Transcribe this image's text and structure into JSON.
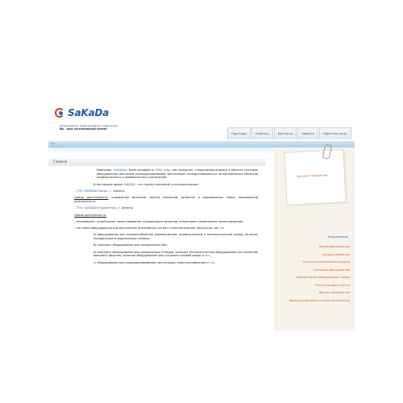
{
  "brand": {
    "logo_text": "SaKaDa",
    "tagline_line1": "Оборудование, проектирование, инвестиции",
    "tagline_line2": "Вы – ваш эксклюзивный клиент"
  },
  "nav": [
    {
      "label": "Партнеры"
    },
    {
      "label": "Клиенты"
    },
    {
      "label": "Контакты"
    },
    {
      "label": "Новости"
    },
    {
      "label": "Обратная связь"
    }
  ],
  "band": {
    "flag_label": "на главную"
  },
  "main": {
    "title": "Главная",
    "intro_company": "Компания",
    "intro_name": "«SAKADA»",
    "intro_founded": "была основана в",
    "intro_year": "1994 году,",
    "intro_rest": "как компания, специализирующаяся в области поставок оборудования для целей кондиционирования, вентиляции, холодоснабжения и теплоснабжения объектов промышленного и коммерческого назначений.",
    "group_intro_a": "В настоящее время",
    "group_intro_b": "SAKADA",
    "group_intro_c": "– это группа компаний, в которую входят:",
    "org1_name": "– ТОО «SAKADA Group»",
    "org1_city": ", г. Алматы",
    "org1_scope_label": "Сфера деятельности:",
    "org1_scope_text": "управление бизнесом группы компаний, развитие и продвижение новых направлений деятельности.",
    "org2_name": "– ТОО «SAKADA Engineering»",
    "org2_city": ", г. Алматы",
    "org2_scope_label": "Сфера деятельности:",
    "org2_item1": "– инжиниринг, инженерное проектирование, координация проектов, инжиниринг инженерное проектирование;",
    "org2_item2": "– поставка оборудования для внутренних инженерных сетей и технологических процессов, как то:",
    "item_a": "а) оборудование для холодоснабжения (коммерческий, промышленный и технологический холод), включая холодильные и морозильные камеры,",
    "item_b": "б) комплекс оборудования для холодильных баз,",
    "item_c": "в) комплекс оборудования для холодильных складов, включая технологическое оборудование для хранения овощей и фруктов, включая оборудование для создания газовой среды и т.п.,",
    "item_d": "г) оборудование для кондиционирования, вентиляции, электроснабжения и т.п.,"
  },
  "sidebar": {
    "note_title": "Каталог продукции",
    "catalog_head": "Направления",
    "items": [
      {
        "label": "Кондиционирование"
      },
      {
        "label": "Холодоснабжение"
      },
      {
        "label": "Очистка и увлажнение воздуха"
      },
      {
        "label": "Пусковое оборудование"
      },
      {
        "label": "Лабораторное оборудование среды"
      },
      {
        "label": "Плиточ-штафы (плита)"
      },
      {
        "label": "Другие направления"
      },
      {
        "label": "Французские вина в тонком исполнении"
      }
    ]
  },
  "colors": {
    "brand_blue": "#1f5fa8",
    "accent_orange": "#d0641a",
    "band_blue": "#a9d0ec"
  }
}
